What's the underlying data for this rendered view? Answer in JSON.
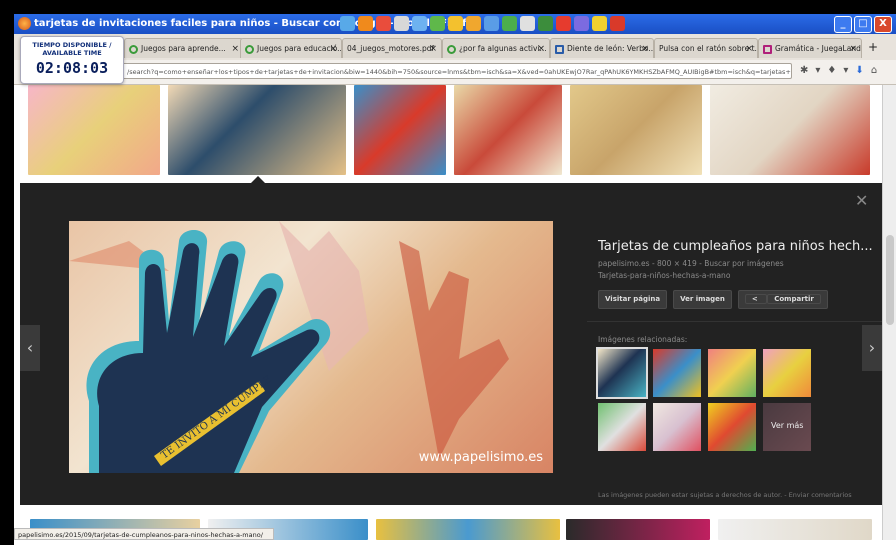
{
  "window": {
    "title": "tarjetas de invitaciones faciles para niños - Buscar con Google - Mozilla Firefox",
    "controls": [
      "_",
      "□",
      "X"
    ]
  },
  "timer": {
    "label": "TIEMPO DISPONIBLE / AVAILABLE TIME",
    "value": "02:08:03"
  },
  "tabs": [
    {
      "label": "Juegos para aprende..."
    },
    {
      "label": "Juegos para educació..."
    },
    {
      "label": "04_juegos_motores.pdf"
    },
    {
      "label": "¿por fa algunas activi..."
    },
    {
      "label": "Diente de león: Verbo..."
    },
    {
      "label": "Pulsa con el ratón sobre t..."
    },
    {
      "label": "Gramática - JuegaLand"
    }
  ],
  "tab_close": "×",
  "tab_new": "+",
  "address": {
    "value": "/search?q=como+enseñar+los+tipos+de+tarjetas+de+invitacion&biw=1440&bih=750&source=lnms&tbm=isch&sa=X&ved=0ahUKEwjO7Rar_qPAhUK6YMKHSZbAFMQ_AUIBigB#tbm=isch&q=tarjetas+de+invitacione"
  },
  "preview": {
    "title": "Tarjetas de cumpleaños para niños hech...",
    "meta": "papelisimo.es - 800 × 419 - Buscar por imágenes",
    "subtitle": "Tarjetas-para-niños-hechas-a-mano",
    "watermark": "www.papelisimo.es",
    "image_caption": "TE INVITO A MI CUMPLE",
    "buttons": [
      "Visitar página",
      "Ver imagen",
      "Compartir"
    ],
    "related_label": "Imágenes relacionadas:",
    "more_label": "Ver más",
    "footer": "Las imágenes pueden estar sujetas a derechos de autor. - Enviar comentarios"
  },
  "status_bar": "papelisimo.es/2015/09/tarjetas-de-cumpleanos-para-ninos-hechas-a-mano/"
}
